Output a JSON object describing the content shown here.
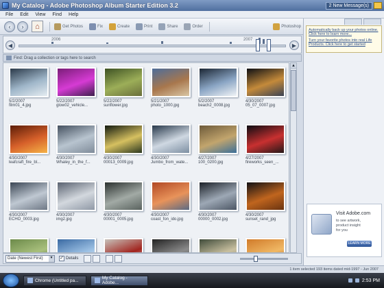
{
  "window": {
    "title": "My Catalog - Adobe Photoshop Album Starter Edition 3.2",
    "new_messages": "2 New Message(s)"
  },
  "menu": [
    "File",
    "Edit",
    "View",
    "Find",
    "Help"
  ],
  "toolbar": {
    "items": [
      {
        "label": "Get Photos",
        "icon": "camera-icon",
        "color": "#b59a5f"
      },
      {
        "label": "Fix",
        "icon": "wand-icon",
        "color": "#7d8fb0"
      },
      {
        "label": "Create",
        "icon": "create-icon",
        "color": "#d3a23a"
      },
      {
        "label": "Print",
        "icon": "printer-icon",
        "color": "#8a9ab3"
      },
      {
        "label": "Share",
        "icon": "share-icon",
        "color": "#95a3b7"
      },
      {
        "label": "Order",
        "icon": "order-icon",
        "color": "#9aa5b5"
      }
    ],
    "right_label": "Photoshop"
  },
  "timeline": {
    "years": [
      "2006",
      "2007"
    ]
  },
  "find_bar": {
    "text": "Find: Drag a collection or tags here to search"
  },
  "photos": [
    {
      "date": "5/2/2007",
      "name": "film01_4.jpg",
      "colors": [
        "#2b3a4a",
        "#9fb6c9",
        "#e5ecf1"
      ]
    },
    {
      "date": "5/22/2007",
      "name": "glow02_vehicle...",
      "colors": [
        "#7a1d78",
        "#d63bd4",
        "#3d1f4d"
      ]
    },
    {
      "date": "5/22/2007",
      "name": "sunflower.jpg",
      "colors": [
        "#3e5224",
        "#9cae58",
        "#6a6f3b"
      ]
    },
    {
      "date": "5/21/2007",
      "name": "photo_1000.jpg",
      "colors": [
        "#4e6d9a",
        "#a8774d",
        "#d9c6a4"
      ]
    },
    {
      "date": "5/2/2007",
      "name": "beach2_0008.jpg",
      "colors": [
        "#1b2634",
        "#8aa5c4",
        "#f1f4f6"
      ]
    },
    {
      "date": "4/30/2007",
      "name": "05_07_0007.jpg",
      "colors": [
        "#0d0f14",
        "#c48a3a",
        "#394254"
      ]
    },
    {
      "date": "4/30/2007",
      "name": "leafcraft_fire_bl...",
      "colors": [
        "#5c1d08",
        "#d6602a",
        "#f5b347"
      ]
    },
    {
      "date": "4/30/2007",
      "name": "Whaley_in_the_f...",
      "colors": [
        "#44505f",
        "#b8c4cf",
        "#7f8b99"
      ]
    },
    {
      "date": "4/30/2007",
      "name": "00013_0009.jpg",
      "colors": [
        "#121a10",
        "#d6c060",
        "#2c3820"
      ]
    },
    {
      "date": "4/30/2007",
      "name": "Jumbo_from_wate...",
      "colors": [
        "#27384a",
        "#cfd8e2",
        "#7d8fa2"
      ]
    },
    {
      "date": "4/27/2007",
      "name": "100_0200.jpg",
      "colors": [
        "#6d5a3a",
        "#c2a56d",
        "#3a6f9a"
      ]
    },
    {
      "date": "4/27/2007",
      "name": "fireworks_seen_...",
      "colors": [
        "#0b0c12",
        "#c83030",
        "#241818"
      ]
    },
    {
      "date": "4/30/2007",
      "name": "ECHO_0003.jpg",
      "colors": [
        "#3b4654",
        "#bfc8d2",
        "#6e7885"
      ]
    },
    {
      "date": "4/30/2007",
      "name": "img2.jpg",
      "colors": [
        "#5a6270",
        "#d3d8de",
        "#8f98a5"
      ]
    },
    {
      "date": "4/30/2007",
      "name": "00001_0005.jpg",
      "colors": [
        "#2c3230",
        "#a2aaa5",
        "#59625e"
      ]
    },
    {
      "date": "4/30/2007",
      "name": "coast_fon_ido.jpg",
      "colors": [
        "#b14824",
        "#e8935a",
        "#5b6a84"
      ]
    },
    {
      "date": "4/30/2007",
      "name": "00000_0002.jpg",
      "colors": [
        "#1c2128",
        "#9da8b5",
        "#4c5664"
      ]
    },
    {
      "date": "4/30/2007",
      "name": "sunset_rand_jpg",
      "colors": [
        "#111114",
        "#c0651e",
        "#6a3310"
      ]
    },
    {
      "date": "",
      "name": "",
      "colors": [
        "#6c8a4a",
        "#a9c07d",
        "#3c5a2c"
      ]
    },
    {
      "date": "",
      "name": "",
      "colors": [
        "#3a6aa3",
        "#9cc0e3",
        "#f1f4f7"
      ]
    },
    {
      "date": "",
      "name": "",
      "colors": [
        "#c7c2bb",
        "#a2251f",
        "#e9e4de"
      ]
    },
    {
      "date": "",
      "name": "",
      "colors": [
        "#222222",
        "#8a8a8a",
        "#4d4d4d"
      ]
    },
    {
      "date": "",
      "name": "",
      "colors": [
        "#3f4b3a",
        "#c9c0a0",
        "#8b8870"
      ]
    },
    {
      "date": "",
      "name": "",
      "colors": [
        "#d07b2a",
        "#f0b865",
        "#9f4d1a"
      ]
    }
  ],
  "bottom_bar": {
    "sort_label": "Date (Newest First)",
    "details_label": "Details"
  },
  "messages": [
    "Automatically back up your photos online. Click here to learn more...",
    "Turn your favorite photos into real Life Products. Click here to get started"
  ],
  "ad": {
    "site": "Visit Adobe.com",
    "line1": "to see artwork,",
    "line2": "product insight",
    "line3": "for you",
    "button": "LEARN MORE"
  },
  "status_text": "1 item selected   193 items dated mid-1997 - Jun 2007",
  "taskbar": {
    "tasks": [
      {
        "label": "Chrome (Untitled pa...",
        "active": false
      },
      {
        "label": "My Catalog - Adobe...",
        "active": true
      }
    ],
    "clock": "2:53 PM"
  }
}
